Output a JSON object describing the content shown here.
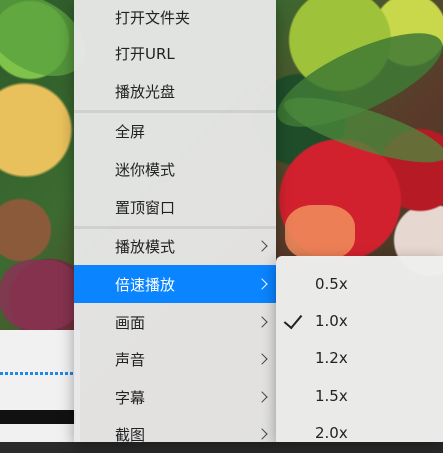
{
  "main_menu": {
    "items": [
      {
        "label": "打开文件夹",
        "has_submenu": false
      },
      {
        "label": "打开URL",
        "has_submenu": false
      },
      {
        "label": "播放光盘",
        "has_submenu": false
      },
      {
        "label": "全屏",
        "has_submenu": false
      },
      {
        "label": "迷你模式",
        "has_submenu": false
      },
      {
        "label": "置顶窗口",
        "has_submenu": false
      },
      {
        "label": "播放模式",
        "has_submenu": true
      },
      {
        "label": "倍速播放",
        "has_submenu": true,
        "active": true
      },
      {
        "label": "画面",
        "has_submenu": true
      },
      {
        "label": "声音",
        "has_submenu": true
      },
      {
        "label": "字幕",
        "has_submenu": true
      },
      {
        "label": "截图",
        "has_submenu": true
      }
    ]
  },
  "speed_menu": {
    "items": [
      {
        "label": "0.5x",
        "checked": false
      },
      {
        "label": "1.0x",
        "checked": true
      },
      {
        "label": "1.2x",
        "checked": false
      },
      {
        "label": "1.5x",
        "checked": false
      },
      {
        "label": "2.0x",
        "checked": false
      }
    ]
  },
  "colors": {
    "accent": "#0a84ff"
  }
}
